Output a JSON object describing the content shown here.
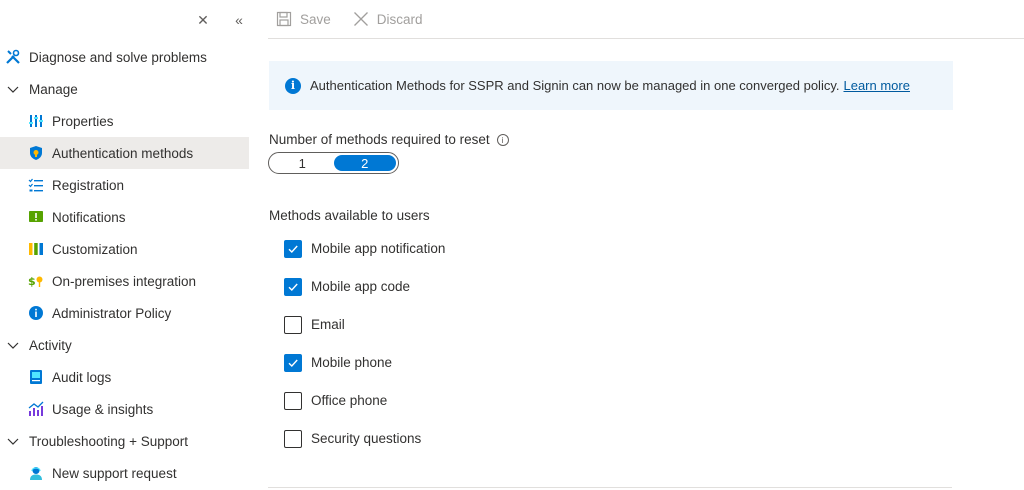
{
  "sidebar": {
    "close_glyph": "✕",
    "collapse_glyph": "«",
    "items": [
      {
        "kind": "top",
        "icon": "diagnose-icon",
        "label": "Diagnose and solve problems"
      },
      {
        "kind": "group",
        "icon": "chevron-down-icon",
        "label": "Manage"
      },
      {
        "kind": "sub",
        "icon": "properties-icon",
        "label": "Properties"
      },
      {
        "kind": "sub",
        "icon": "authentication-methods-icon",
        "label": "Authentication methods",
        "selected": true
      },
      {
        "kind": "sub",
        "icon": "registration-icon",
        "label": "Registration"
      },
      {
        "kind": "sub",
        "icon": "notifications-icon",
        "label": "Notifications"
      },
      {
        "kind": "sub",
        "icon": "customization-icon",
        "label": "Customization"
      },
      {
        "kind": "sub",
        "icon": "on-premises-integration-icon",
        "label": "On-premises integration"
      },
      {
        "kind": "sub",
        "icon": "administrator-policy-icon",
        "label": "Administrator Policy"
      },
      {
        "kind": "group",
        "icon": "chevron-down-icon",
        "label": "Activity"
      },
      {
        "kind": "sub",
        "icon": "audit-logs-icon",
        "label": "Audit logs"
      },
      {
        "kind": "sub",
        "icon": "usage-insights-icon",
        "label": "Usage & insights"
      },
      {
        "kind": "group",
        "icon": "chevron-down-icon",
        "label": "Troubleshooting + Support"
      },
      {
        "kind": "sub",
        "icon": "support-request-icon",
        "label": "New support request"
      }
    ]
  },
  "toolbar": {
    "save_label": "Save",
    "discard_label": "Discard"
  },
  "banner": {
    "text": "Authentication Methods for SSPR and Signin can now be managed in one converged policy.",
    "link_label": "Learn more",
    "info_glyph": "i"
  },
  "reset": {
    "label": "Number of methods required to reset",
    "info_glyph": "i",
    "options": [
      "1",
      "2"
    ],
    "selected": "2"
  },
  "methods": {
    "label": "Methods available to users",
    "items": [
      {
        "label": "Mobile app notification",
        "checked": true
      },
      {
        "label": "Mobile app code",
        "checked": true
      },
      {
        "label": "Email",
        "checked": false
      },
      {
        "label": "Mobile phone",
        "checked": true
      },
      {
        "label": "Office phone",
        "checked": false
      },
      {
        "label": "Security questions",
        "checked": false
      }
    ]
  },
  "colors": {
    "accent": "#0078d4",
    "banner_bg": "#eff6fc",
    "selected_bg": "#edebe9",
    "disabled_text": "#a19f9d"
  }
}
